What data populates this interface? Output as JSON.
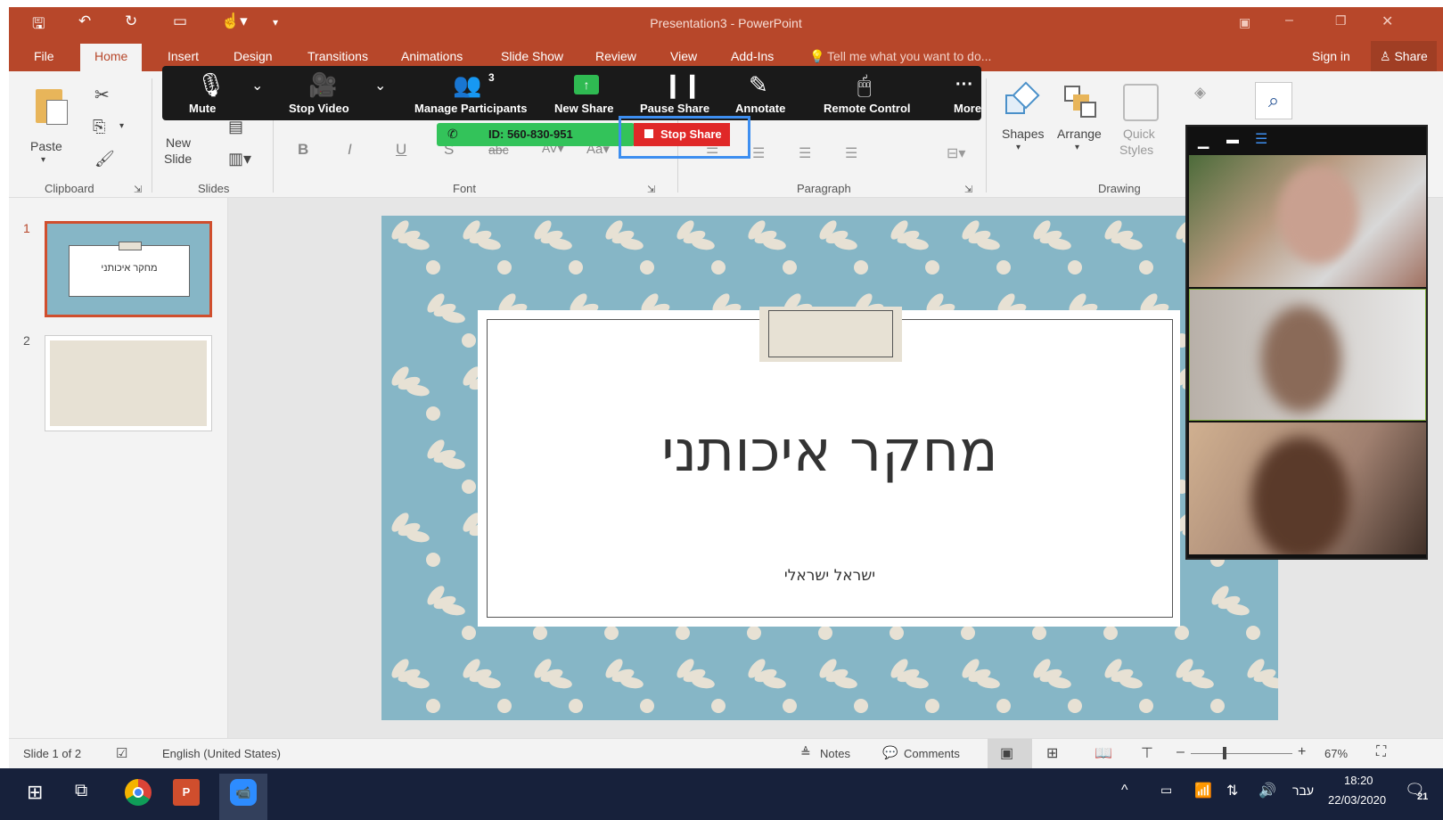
{
  "window": {
    "title": "Presentation3 - PowerPoint",
    "sign_in": "Sign in",
    "share": "Share"
  },
  "tabs": [
    {
      "label": "File"
    },
    {
      "label": "Home"
    },
    {
      "label": "Insert"
    },
    {
      "label": "Design"
    },
    {
      "label": "Transitions"
    },
    {
      "label": "Animations"
    },
    {
      "label": "Slide Show"
    },
    {
      "label": "Review"
    },
    {
      "label": "View"
    },
    {
      "label": "Add-Ins"
    }
  ],
  "tell_me": "Tell me what you want to do...",
  "ribbon": {
    "clipboard": "Clipboard",
    "paste": "Paste",
    "slides": "Slides",
    "new_slide_1": "New",
    "new_slide_2": "Slide",
    "font": "Font",
    "paragraph": "Paragraph",
    "drawing": "Drawing",
    "shapes": "Shapes",
    "arrange": "Arrange",
    "quick_1": "Quick",
    "quick_2": "Styles"
  },
  "zoom": {
    "mute": "Mute",
    "stop_video": "Stop Video",
    "manage": "Manage Participants",
    "participants_count": "3",
    "new_share": "New Share",
    "pause_share": "Pause Share",
    "annotate": "Annotate",
    "remote": "Remote Control",
    "more": "More",
    "meeting_id": "ID: 560-830-951",
    "stop_share": "Stop Share"
  },
  "slides": [
    {
      "number": "1"
    },
    {
      "number": "2"
    }
  ],
  "slide": {
    "title": "מחקר איכותני",
    "subtitle": "ישראל ישראלי"
  },
  "status": {
    "slide_info": "Slide 1 of 2",
    "language": "English (United States)",
    "notes": "Notes",
    "comments": "Comments",
    "zoom": "67%"
  },
  "taskbar": {
    "lang": "עבר",
    "time": "18:20",
    "date": "22/03/2020",
    "notif": "21"
  }
}
